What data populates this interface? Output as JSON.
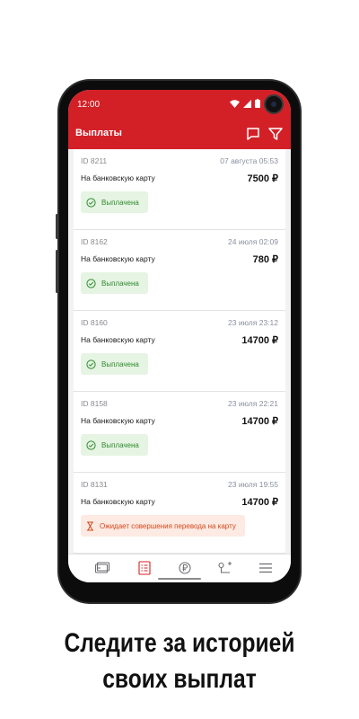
{
  "status_bar": {
    "time": "12:00"
  },
  "app_bar": {
    "title": "Выплаты",
    "icons": [
      "chat-icon",
      "filter-icon"
    ]
  },
  "colors": {
    "brand_red": "#d32027",
    "paid_green": "#2e8b2e",
    "paid_bg": "#e6f4e3",
    "pending_orange": "#d4491e",
    "pending_bg": "#fdeae2"
  },
  "payouts": [
    {
      "id": "ID 8211",
      "date": "07 августа 05:53",
      "method": "На банковскую карту",
      "amount": "7500 ₽",
      "status": "Выплачена",
      "status_type": "paid"
    },
    {
      "id": "ID 8162",
      "date": "24 июля 02:09",
      "method": "На банковскую карту",
      "amount": "780 ₽",
      "status": "Выплачена",
      "status_type": "paid"
    },
    {
      "id": "ID 8160",
      "date": "23 июля 23:12",
      "method": "На банковскую карту",
      "amount": "14700 ₽",
      "status": "Выплачена",
      "status_type": "paid"
    },
    {
      "id": "ID 8158",
      "date": "23 июля 22:21",
      "method": "На банковскую карту",
      "amount": "14700 ₽",
      "status": "Выплачена",
      "status_type": "paid"
    },
    {
      "id": "ID 8131",
      "date": "23 июля 19:55",
      "method": "На банковскую карту",
      "amount": "14700 ₽",
      "status": "Ожидает совершения перевода на карту",
      "status_type": "pending"
    }
  ],
  "bottom_nav": [
    {
      "icon": "cards-icon",
      "active": false
    },
    {
      "icon": "payouts-list-icon",
      "active": true
    },
    {
      "icon": "ruble-exchange-icon",
      "active": false
    },
    {
      "icon": "route-icon",
      "active": false
    },
    {
      "icon": "menu-icon",
      "active": false
    }
  ],
  "caption": {
    "line1": "Следите за историей",
    "line2": "своих выплат"
  }
}
